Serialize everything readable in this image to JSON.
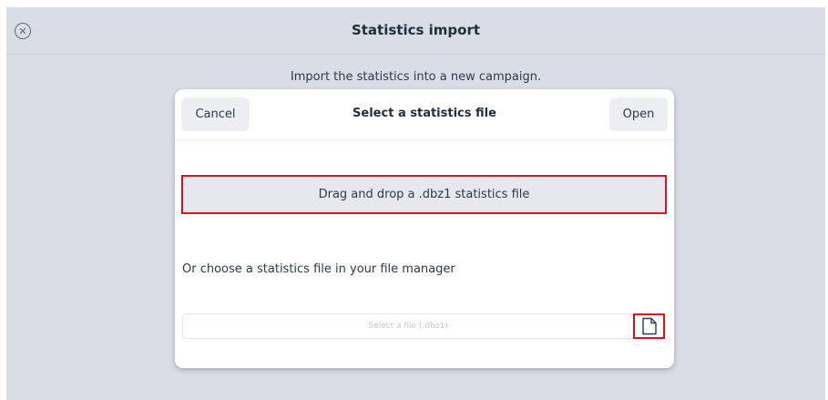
{
  "header": {
    "close_icon": "close-circle-icon",
    "title": "Statistics import"
  },
  "subtitle": "Import the statistics into a new campaign.",
  "dialog": {
    "cancel_label": "Cancel",
    "title": "Select a statistics file",
    "open_label": "Open",
    "dropzone_text": "Drag and drop a .dbz1 statistics file",
    "or_text": "Or choose a statistics file in your file manager",
    "file_input_placeholder": "Select a file (.dbz1)",
    "file_icon": "document-icon"
  },
  "colors": {
    "background": "#d9dee4",
    "highlight": "#d9121f"
  }
}
